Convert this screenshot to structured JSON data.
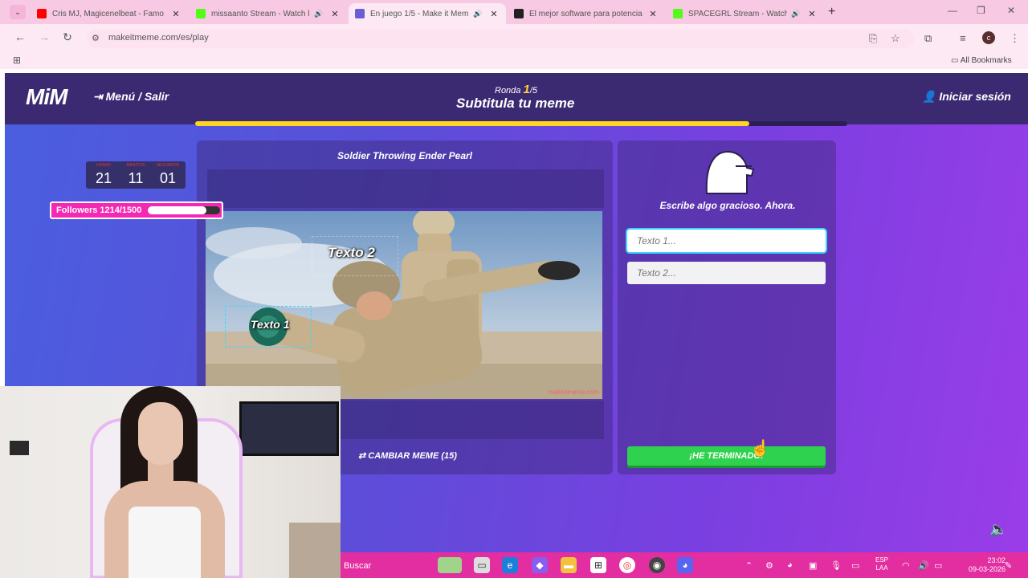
{
  "browser": {
    "tabs": [
      {
        "title": "Cris MJ, Magicenelbeat - Famo",
        "fav_color": "#ff0000",
        "audio": false
      },
      {
        "title": "missaanto Stream - Watch l",
        "fav_color": "#53fc18",
        "audio": true
      },
      {
        "title": "En juego 1/5 - Make it Mem",
        "fav_color": "#6b5dd3",
        "audio": true,
        "active": true
      },
      {
        "title": "El mejor software para potencia",
        "fav_color": "#222222",
        "audio": false
      },
      {
        "title": "SPACEGRL Stream - Watch",
        "fav_color": "#53fc18",
        "audio": true
      }
    ],
    "url": "makeitmeme.com/es/play",
    "profile_initial": "c",
    "all_bookmarks": "All Bookmarks"
  },
  "header": {
    "logo": "MiM",
    "menu_exit": "Menú / Salir",
    "round_prefix": "Ronda ",
    "round_current": "1",
    "round_total": "/5",
    "phase": "Subtitula tu meme",
    "login": "Iniciar sesión",
    "timer_progress": 0.85
  },
  "meme": {
    "title": "Soldier Throwing Ender Pearl",
    "caption1": "Texto 1",
    "caption2": "Texto 2",
    "watermark": "makeitmeme.com",
    "change_meme": "CAMBIAR MEME (15)"
  },
  "caption_panel": {
    "prompt": "Escribe algo gracioso. Ahora.",
    "input1_placeholder": "Texto 1...",
    "input2_placeholder": "Texto 2...",
    "done": "¡HE TERMINADO!"
  },
  "streak": {
    "labels": [
      "HORAS",
      "MINUTOS",
      "SEGUNDOS"
    ],
    "values": [
      "21",
      "11",
      "01"
    ]
  },
  "followers": {
    "label": "Followers 1214/1500",
    "progress": 0.81
  },
  "taskbar": {
    "search": "Buscar",
    "lang_line1": "ESP",
    "lang_line2": "LAA",
    "time": "23:02",
    "date": "09-03-2026"
  }
}
